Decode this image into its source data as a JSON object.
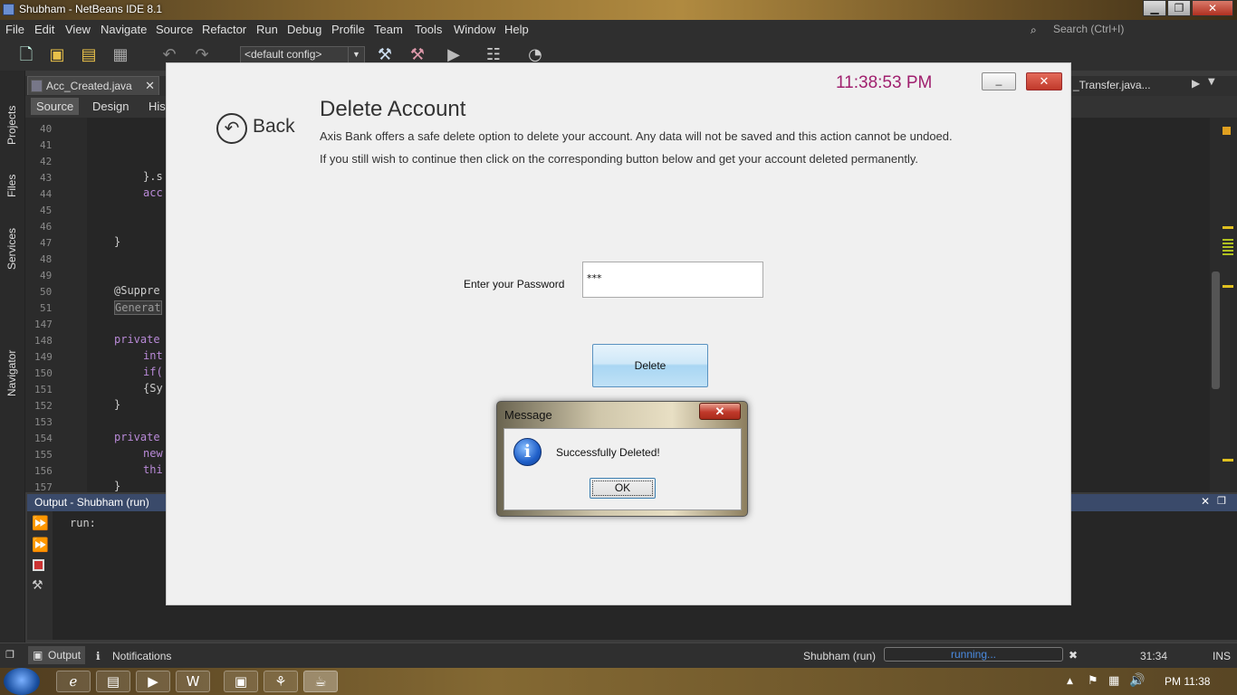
{
  "ide": {
    "title": "Shubham - NetBeans IDE 8.1",
    "menu": [
      "File",
      "Edit",
      "View",
      "Navigate",
      "Source",
      "Refactor",
      "Run",
      "Debug",
      "Profile",
      "Team",
      "Tools",
      "Window",
      "Help"
    ],
    "search_placeholder": "Search (Ctrl+I)",
    "config": "<default config>",
    "tab_left": "Acc_Created.java",
    "tab_right": "_Transfer.java...",
    "subtabs": [
      "Source",
      "Design",
      "His"
    ],
    "side_labels": [
      "Projects",
      "Files",
      "Services",
      "Navigator"
    ],
    "line_numbers": [
      "40",
      "41",
      "42",
      "43",
      "44",
      "45",
      "46",
      "47",
      "48",
      "49",
      "50",
      "51",
      "147",
      "148",
      "149",
      "150",
      "151",
      "152",
      "153",
      "154",
      "155",
      "156",
      "157"
    ],
    "code_fragments": [
      "}.s",
      "acc",
      "}",
      "@Suppre",
      "Generat",
      "private",
      "int",
      "if(",
      "{Sy",
      "}",
      "private",
      "new",
      "thi",
      "}"
    ],
    "output_title": "Output - Shubham (run)",
    "output_text": "run:",
    "status": {
      "output_tab": "Output",
      "notifications_tab": "Notifications",
      "run_name": "Shubham (run)",
      "progress_text": "running...",
      "position": "31:34",
      "mode": "INS"
    }
  },
  "taskbar": {
    "clock": "PM 11:38"
  },
  "app": {
    "clock": "11:38:53 PM",
    "min_label": "_",
    "close_label": "✕",
    "back_label": "Back",
    "heading": "Delete Account",
    "desc_line1": "Axis Bank offers a safe delete option to delete your account. Any data will not be saved and this action cannot be undoed.",
    "desc_line2": "If you still wish to continue then click on the corresponding button below and get your account deleted permanently.",
    "password_label": "Enter your Password",
    "password_value": "***",
    "delete_button": "Delete"
  },
  "dialog": {
    "title": "Message",
    "message": "Successfully Deleted!",
    "ok": "OK"
  },
  "colors": {
    "clock": "#a0206e",
    "ide_bg": "#2b2b2b",
    "app_bg": "#f0f0f0",
    "delete_btn": "#bfe1f6"
  }
}
